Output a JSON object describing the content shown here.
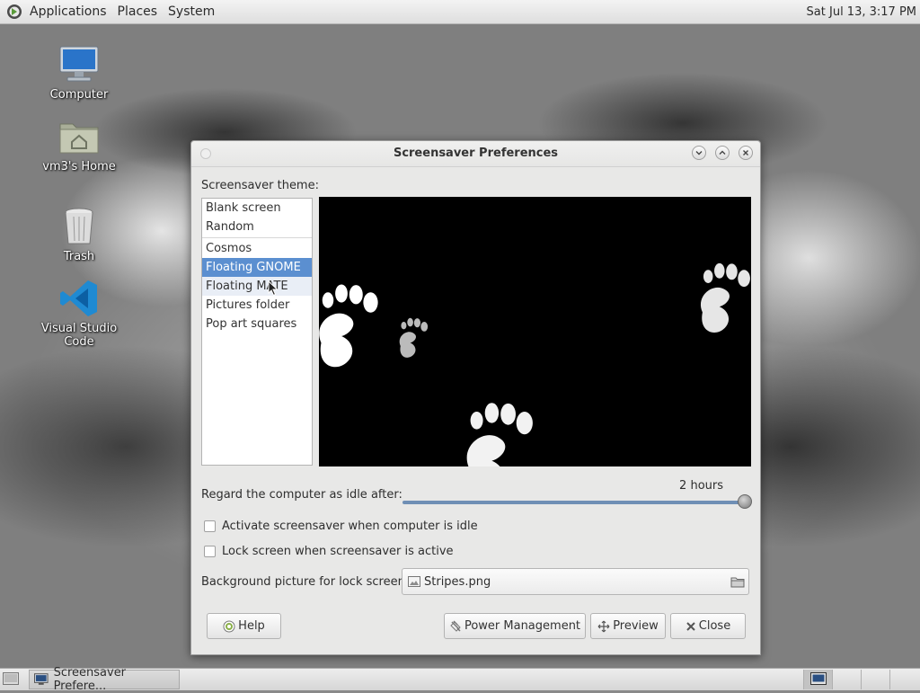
{
  "top_panel": {
    "menu": [
      "Applications",
      "Places",
      "System"
    ],
    "clock": "Sat Jul 13,  3:17 PM"
  },
  "desktop_icons": [
    {
      "label": "Computer",
      "icon": "computer-icon"
    },
    {
      "label": "vm3's Home",
      "icon": "home-folder-icon"
    },
    {
      "label": "Trash",
      "icon": "trash-icon"
    },
    {
      "label": "Visual Studio Code",
      "icon": "vscode-icon"
    }
  ],
  "window": {
    "title": "Screensaver Preferences",
    "theme_label": "Screensaver theme:",
    "themes": [
      "Blank screen",
      "Random",
      "Cosmos",
      "Floating GNOME",
      "Floating MATE",
      "Pictures folder",
      "Pop art squares"
    ],
    "selected_theme": "Floating GNOME",
    "idle_label": "Regard the computer as idle after:",
    "idle_value": "2 hours",
    "idle_fraction": 1.0,
    "activate_label": "Activate screensaver when computer is idle",
    "lock_label": "Lock screen when screensaver is active",
    "activate_checked": false,
    "lock_checked": false,
    "bg_label": "Background picture for lock screen:",
    "bg_file": "Stripes.png",
    "buttons": {
      "help": "Help",
      "power": "Power Management",
      "preview": "Preview",
      "close": "Close"
    }
  },
  "taskbar": {
    "task_label": "Screensaver Prefere..."
  },
  "colors": {
    "selection": "#5b8fd0",
    "slider": "#6f8fb5",
    "vscode": "#1f8ad2"
  }
}
